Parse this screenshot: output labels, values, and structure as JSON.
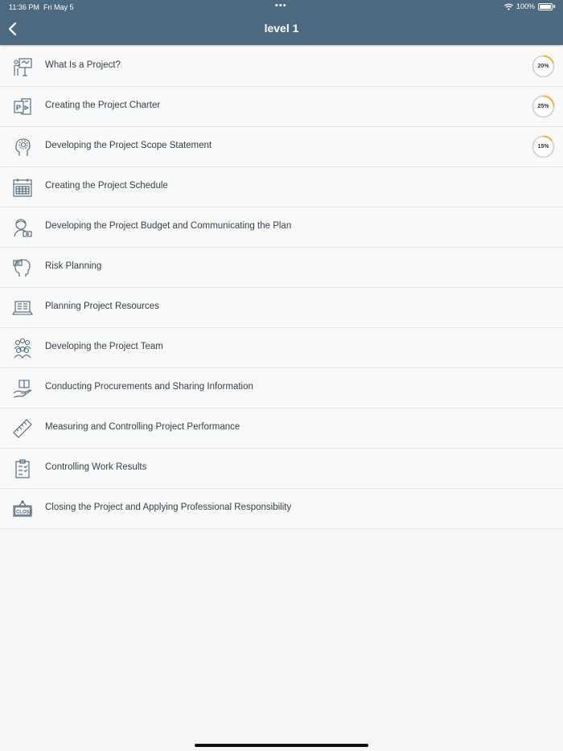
{
  "status": {
    "time": "11:36 PM",
    "date": "Fri May 5",
    "dots": "•••",
    "battery": "100%"
  },
  "header": {
    "title": "level 1"
  },
  "colors": {
    "header_bg": "#4e6a80",
    "progress_track": "#c9cfd4",
    "progress_fill": "#f5a623"
  },
  "items": [
    {
      "label": "What Is a Project?",
      "icon": "presentation-board-icon",
      "progress": "20%",
      "progress_value": 0.2
    },
    {
      "label": "Creating the Project Charter",
      "icon": "presentation-file-icon",
      "progress": "25%",
      "progress_value": 0.25
    },
    {
      "label": "Developing the Project Scope Statement",
      "icon": "head-gear-icon",
      "progress": "15%",
      "progress_value": 0.15
    },
    {
      "label": "Creating the Project Schedule",
      "icon": "calendar-icon"
    },
    {
      "label": "Developing the Project Budget and Communicating the Plan",
      "icon": "person-money-icon"
    },
    {
      "label": "Risk Planning",
      "icon": "head-risk-icon"
    },
    {
      "label": "Planning Project Resources",
      "icon": "laptop-icon"
    },
    {
      "label": "Developing the Project Team",
      "icon": "team-icon"
    },
    {
      "label": "Conducting Procurements and Sharing Information",
      "icon": "hand-book-icon"
    },
    {
      "label": "Measuring and Controlling Project Performance",
      "icon": "ruler-icon"
    },
    {
      "label": "Controlling Work Results",
      "icon": "checklist-icon"
    },
    {
      "label": "Closing the Project and Applying Professional Responsibility",
      "icon": "close-sign-icon",
      "icon_text": "CLOSE"
    }
  ]
}
